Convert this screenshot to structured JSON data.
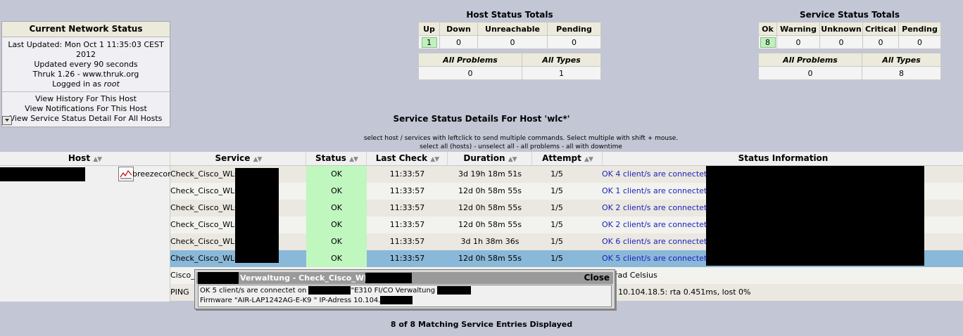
{
  "network": {
    "title": "Current Network Status",
    "last_updated": "Last Updated: Mon Oct 1 11:35:03 CEST 2012",
    "update_interval": "Updated every 90 seconds",
    "version": "Thruk 1.26 - www.thruk.org",
    "logged_in_prefix": "Logged in as ",
    "user": "root",
    "links": [
      "View History For This Host",
      "View Notifications For This Host",
      "View Service Status Detail For All Hosts"
    ]
  },
  "host_totals": {
    "title": "Host Status Totals",
    "headers": [
      "Up",
      "Down",
      "Unreachable",
      "Pending"
    ],
    "values": [
      "1",
      "0",
      "0",
      "0"
    ],
    "sub_headers": [
      "All Problems",
      "All Types"
    ],
    "sub_values": [
      "0",
      "1"
    ]
  },
  "service_totals": {
    "title": "Service Status Totals",
    "headers": [
      "Ok",
      "Warning",
      "Unknown",
      "Critical",
      "Pending"
    ],
    "values": [
      "8",
      "0",
      "0",
      "0",
      "0"
    ],
    "sub_headers": [
      "All Problems",
      "All Types"
    ],
    "sub_values": [
      "0",
      "8"
    ]
  },
  "details": {
    "title": "Service Status Details For Host 'wlc*'",
    "hint1": "select host / services with leftclick to send multiple commands. Select multiple with shift + mouse.",
    "hint2": "select all (hosts) - unselect all - all problems - all with downtime",
    "columns": [
      "Host",
      "Service",
      "Status",
      "Last Check",
      "Duration",
      "Attempt",
      "Status Information"
    ],
    "sort_glyph": "▲▼",
    "host_name": "breezecom",
    "rows": [
      {
        "service": "Check_Cisco_WLC_",
        "status": "OK",
        "last_check": "11:33:57",
        "duration": "3d 19h 18m 51s",
        "attempt": "1/5",
        "info": "OK 4 client/s are connectet on"
      },
      {
        "service": "Check_Cisco_WLC_",
        "status": "OK",
        "last_check": "11:33:57",
        "duration": "12d 0h 58m 55s",
        "attempt": "1/5",
        "info": "OK 1 client/s are connectet on"
      },
      {
        "service": "Check_Cisco_WLC_",
        "status": "OK",
        "last_check": "11:33:57",
        "duration": "12d 0h 58m 55s",
        "attempt": "1/5",
        "info": "OK 2 client/s are connectet on"
      },
      {
        "service": "Check_Cisco_WLC_",
        "status": "OK",
        "last_check": "11:33:57",
        "duration": "12d 0h 58m 55s",
        "attempt": "1/5",
        "info": "OK 2 client/s are connectet on"
      },
      {
        "service": "Check_Cisco_WLC_",
        "status": "OK",
        "last_check": "11:33:57",
        "duration": "3d 1h 38m 36s",
        "attempt": "1/5",
        "info": "OK 6 client/s are connectet on"
      },
      {
        "service": "Check_Cisco_WLC_",
        "status": "OK",
        "last_check": "11:33:57",
        "duration": "12d 0h 58m 55s",
        "attempt": "1/5",
        "info": "OK 5 client/s are connectet on"
      },
      {
        "service": "Cisco_",
        "status": "",
        "last_check": "",
        "duration": "",
        "attempt": "",
        "info": "rad Celsius"
      },
      {
        "service": "PING",
        "status": "",
        "last_check": "",
        "duration": "",
        "attempt": "",
        "info": "10.104.18.5: rta 0.451ms, lost 0%"
      }
    ],
    "footer": "8 of 8 Matching Service Entries Displayed"
  },
  "popup": {
    "title": "Verwaltung - Check_Cisco_WLC",
    "close": "Close",
    "line1_a": "OK 5 client/s are connectet on",
    "line1_b": "\"E310 FI/CO Verwaltung",
    "line2": "Firmware \"AIR-LAP1242AG-E-K9 \" IP-Adress 10.104."
  },
  "colors": {
    "ok": "#bff7bf",
    "selected_row": "#8ab8d8",
    "info_text": "#1a1fbc",
    "background": "#c3c6d4"
  }
}
